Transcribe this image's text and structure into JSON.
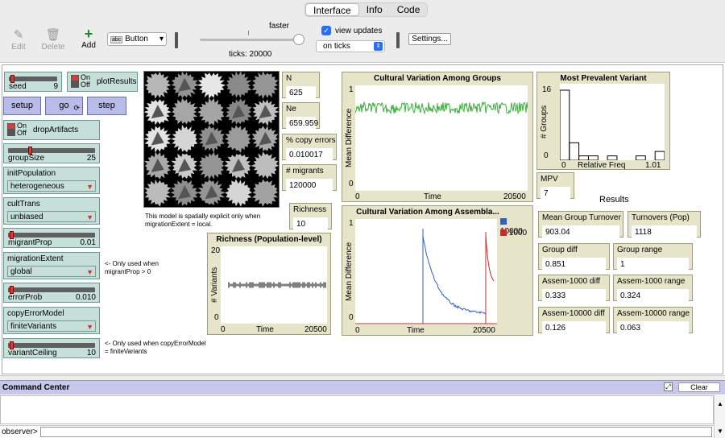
{
  "tabs": [
    "Interface",
    "Info",
    "Code"
  ],
  "toolbar": {
    "edit": "Edit",
    "delete": "Delete",
    "add": "Add",
    "widget_type": "Button",
    "speed_label": "faster",
    "ticks": "ticks: 20000",
    "view_updates": "view updates",
    "update_mode": "on ticks",
    "settings": "Settings..."
  },
  "widgets": {
    "seed": {
      "label": "seed",
      "value": "9"
    },
    "plotResults": {
      "on": "On",
      "off": "Off",
      "label": "plotResults"
    },
    "setup": "setup",
    "go": "go",
    "step": "step",
    "dropArtifacts": {
      "on": "On",
      "off": "Off",
      "label": "dropArtifacts"
    },
    "groupSize": {
      "label": "groupSize",
      "value": "25"
    },
    "initPopulation": {
      "label": "initPopulation",
      "value": "heterogeneous"
    },
    "cultTrans": {
      "label": "cultTrans",
      "value": "unbiased"
    },
    "migrantProp": {
      "label": "migrantProp",
      "value": "0.01"
    },
    "migrationExtent": {
      "label": "migrationExtent",
      "value": "global"
    },
    "errorProb": {
      "label": "errorProb",
      "value": "0.010"
    },
    "copyErrorModel": {
      "label": "copyErrorModel",
      "value": "finiteVariants"
    },
    "variantCeiling": {
      "label": "variantCeiling",
      "value": "10"
    }
  },
  "notes": {
    "spatial": "This model is spatially explicit only when migrationExtent = local.",
    "migration": "<- Only used when migrantProp > 0",
    "copyerror": "<- Only used when copyErrorModel = finiteVariants",
    "results": "Results"
  },
  "monitors": {
    "N": {
      "label": "N",
      "value": "625"
    },
    "Ne": {
      "label": "Ne",
      "value": "659.959"
    },
    "copy_errors": {
      "label": "% copy errors",
      "value": "0.010017"
    },
    "migrants": {
      "label": "# migrants",
      "value": "120000"
    },
    "richness": {
      "label": "Richness",
      "value": "10"
    },
    "mpv": {
      "label": "MPV",
      "value": "7"
    },
    "mean_group_turnover": {
      "label": "Mean Group Turnover",
      "value": "903.04"
    },
    "turnovers_pop": {
      "label": "Turnovers (Pop)",
      "value": "1118"
    },
    "group_diff": {
      "label": "Group diff",
      "value": "0.851"
    },
    "group_range": {
      "label": "Group range",
      "value": "1"
    },
    "assem1000_diff": {
      "label": "Assem-1000 diff",
      "value": "0.333"
    },
    "assem1000_range": {
      "label": "Assem-1000 range",
      "value": "0.324"
    },
    "assem10000_diff": {
      "label": "Assem-10000 diff",
      "value": "0.126"
    },
    "assem10000_range": {
      "label": "Assem-10000 range",
      "value": "0.063"
    }
  },
  "plots": {
    "groups": {
      "title": "Cultural Variation Among Groups",
      "ylabel": "Mean Difference",
      "xlabel": "Time",
      "ymin": "0",
      "ymax": "1",
      "xmin": "0",
      "xmax": "20500"
    },
    "assemblages": {
      "title": "Cultural Variation Among Assembla...",
      "ylabel": "Mean Difference",
      "xlabel": "Time",
      "ymin": "0",
      "ymax": "1",
      "xmin": "0",
      "xmax": "20500",
      "legend": [
        "10000",
        "1000"
      ]
    },
    "richness": {
      "title": "Richness (Population-level)",
      "ylabel": "# Variants",
      "xlabel": "Time",
      "ymin": "0",
      "ymax": "20",
      "xmin": "0",
      "xmax": "20500"
    },
    "prevalent": {
      "title": "Most Prevalent Variant",
      "ylabel": "# Groups",
      "xlabel": "Relative Freq",
      "ymin": "0",
      "ymax": "16",
      "xmin": "0",
      "xmax": "1.01"
    }
  },
  "colors": {
    "green": "#3bb03b",
    "blue": "#2f5fc8",
    "red": "#d02828"
  },
  "command_center": {
    "title": "Command Center",
    "clear": "Clear",
    "prompt": "observer>"
  }
}
